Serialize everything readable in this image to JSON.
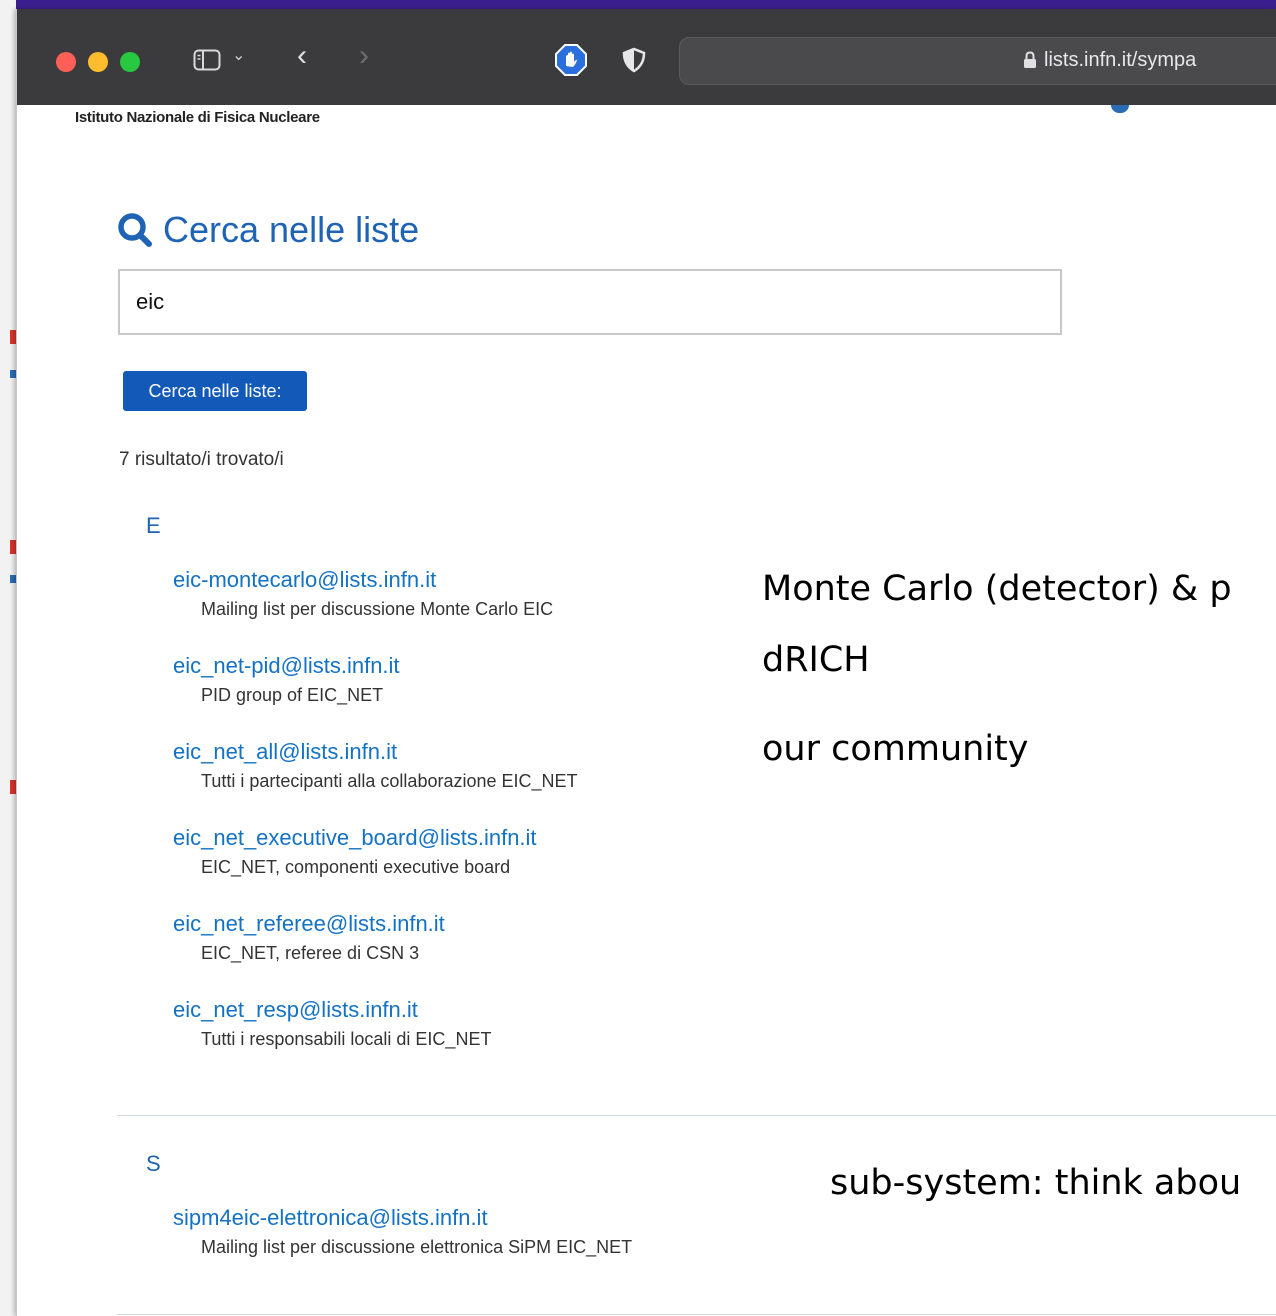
{
  "browser": {
    "url": "lists.infn.it/sympa"
  },
  "header": {
    "institute": "Istituto Nazionale di Fisica Nucleare"
  },
  "search": {
    "title": "Cerca nelle liste",
    "query": "eic",
    "button_label": "Cerca nelle liste:",
    "result_count": "7 risultato/i trovato/i"
  },
  "groups": [
    {
      "letter": "E",
      "items": [
        {
          "address": "eic-montecarlo@lists.infn.it",
          "description": "Mailing list per discussione Monte Carlo EIC"
        },
        {
          "address": "eic_net-pid@lists.infn.it",
          "description": "PID group of EIC_NET"
        },
        {
          "address": "eic_net_all@lists.infn.it",
          "description": "Tutti i partecipanti alla collaborazione EIC_NET"
        },
        {
          "address": "eic_net_executive_board@lists.infn.it",
          "description": "EIC_NET, componenti executive board"
        },
        {
          "address": "eic_net_referee@lists.infn.it",
          "description": "EIC_NET, referee di CSN 3"
        },
        {
          "address": "eic_net_resp@lists.infn.it",
          "description": "Tutti i responsabili locali di EIC_NET"
        }
      ]
    },
    {
      "letter": "S",
      "items": [
        {
          "address": "sipm4eic-elettronica@lists.infn.it",
          "description": "Mailing list per discussione elettronica SiPM EIC_NET"
        }
      ]
    }
  ],
  "annotations": {
    "montecarlo": "Monte Carlo (detector) & p",
    "drich": "dRICH",
    "community": "our community",
    "subsystem": "sub-system: think abou"
  },
  "colors": {
    "link": "#1472c4",
    "title": "#1f63b4",
    "button": "#135ab8",
    "toolbar": "#3b3b3d"
  }
}
